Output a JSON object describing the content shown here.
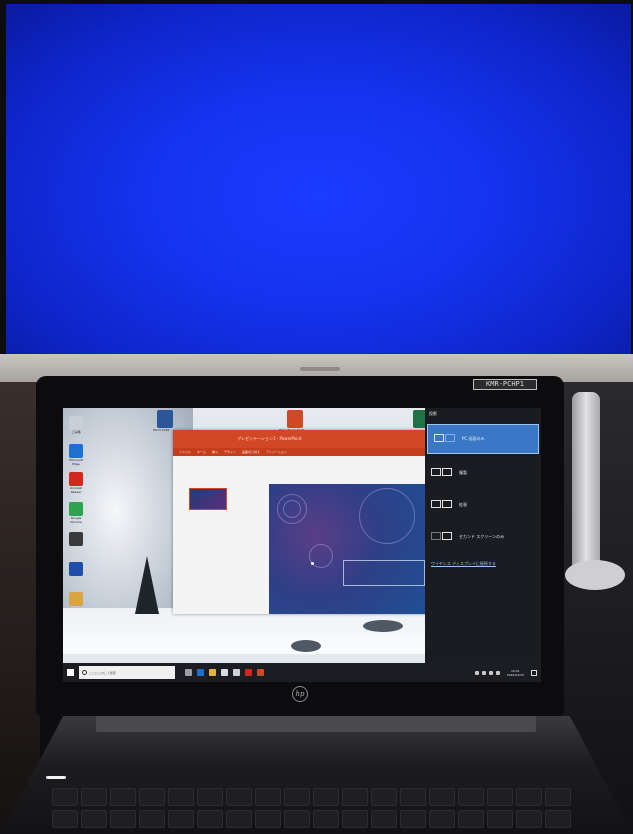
{
  "monitor": {
    "brand": "",
    "screen_color": "#1533ee"
  },
  "laptop": {
    "sticker": "KMR-PCHP1",
    "lid_label": "",
    "brand_logo": "hp"
  },
  "desktop": {
    "icons": [
      {
        "label": "ごみ箱",
        "icon": "recycle-bin-icon",
        "color": "#c9cfd6"
      },
      {
        "label": "Microsoft Edge",
        "icon": "edge-icon",
        "color": "#1f6fd0"
      },
      {
        "label": "Acrobat Reader",
        "icon": "acrobat-icon",
        "color": "#d4261c"
      },
      {
        "label": "Google Chrome",
        "icon": "chrome-icon",
        "color": "#2ea44f"
      },
      {
        "label": "",
        "icon": "app-icon",
        "color": "#3a3a3a"
      },
      {
        "label": "",
        "icon": "app-icon",
        "color": "#1d4fa8"
      },
      {
        "label": "",
        "icon": "folder-icon",
        "color": "#d9a441"
      }
    ]
  },
  "task_view": {
    "apps": [
      {
        "label": "Word 2016",
        "icon": "word-icon",
        "color": "#2b579a"
      },
      {
        "label": "PowerPoint 2016",
        "icon": "powerpoint-icon",
        "color": "#d24726"
      },
      {
        "label": "",
        "icon": "excel-icon",
        "color": "#217346"
      }
    ]
  },
  "powerpoint": {
    "title": "プレゼンテーション1 - PowerPoint",
    "ribbon_tabs": [
      "ファイル",
      "ホーム",
      "挿入",
      "デザイン",
      "画面切り替え",
      "アニメーション"
    ],
    "accent_color": "#d24726"
  },
  "project_panel": {
    "title": "投影",
    "options": [
      {
        "label": "PC 画面のみ",
        "selected": true
      },
      {
        "label": "複製",
        "selected": false
      },
      {
        "label": "拡張",
        "selected": false
      },
      {
        "label": "セカンド スクリーンのみ",
        "selected": false
      }
    ],
    "wireless_link": "ワイヤレス ディスプレイに接続する",
    "selected_color": "#3a78c7"
  },
  "taskbar": {
    "search_placeholder": "ここに入力して検索",
    "clock_time": "16:01",
    "clock_date": "2019/02/25"
  }
}
